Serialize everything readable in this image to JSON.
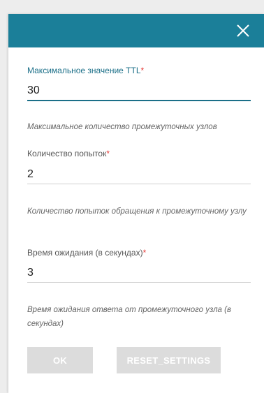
{
  "dialog": {
    "header_color": "#1b7f99",
    "close_icon": "close-icon"
  },
  "fields": [
    {
      "label": "Максимальное значение TTL",
      "required_mark": "*",
      "value": "30",
      "hint": "Максимальное количество промежуточных узлов"
    },
    {
      "label": "Количество попыток",
      "required_mark": "*",
      "value": "2",
      "hint": "Количество попыток обращения к промежуточному узлу"
    },
    {
      "label": "Время ожидания (в секундах)",
      "required_mark": "*",
      "value": "3",
      "hint": "Время ожидания ответа от промежуточного узла (в секундах)"
    }
  ],
  "buttons": {
    "ok_label": "OK",
    "reset_label": "RESET_SETTINGS"
  }
}
